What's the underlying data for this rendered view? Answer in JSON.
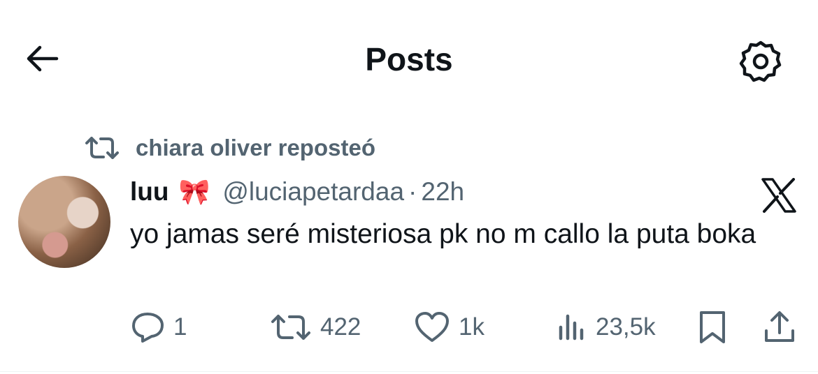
{
  "header": {
    "title": "Posts",
    "back_icon": "arrow-left-icon",
    "settings_icon": "gear-icon"
  },
  "repost": {
    "text": "chiara oliver reposteó",
    "icon": "repost-icon"
  },
  "post": {
    "author_name": "luu",
    "author_emoji": "🎀",
    "handle": "@luciapetardaa",
    "separator": "·",
    "time": "22h",
    "text": "yo jamas seré misteriosa pk no m callo la puta boka",
    "source_icon": "x-logo-icon"
  },
  "actions": {
    "replies": "1",
    "reposts": "422",
    "likes": "1k",
    "views": "23,5k"
  },
  "colors": {
    "text": "#0f1419",
    "secondary": "#536471",
    "background": "#ffffff"
  }
}
